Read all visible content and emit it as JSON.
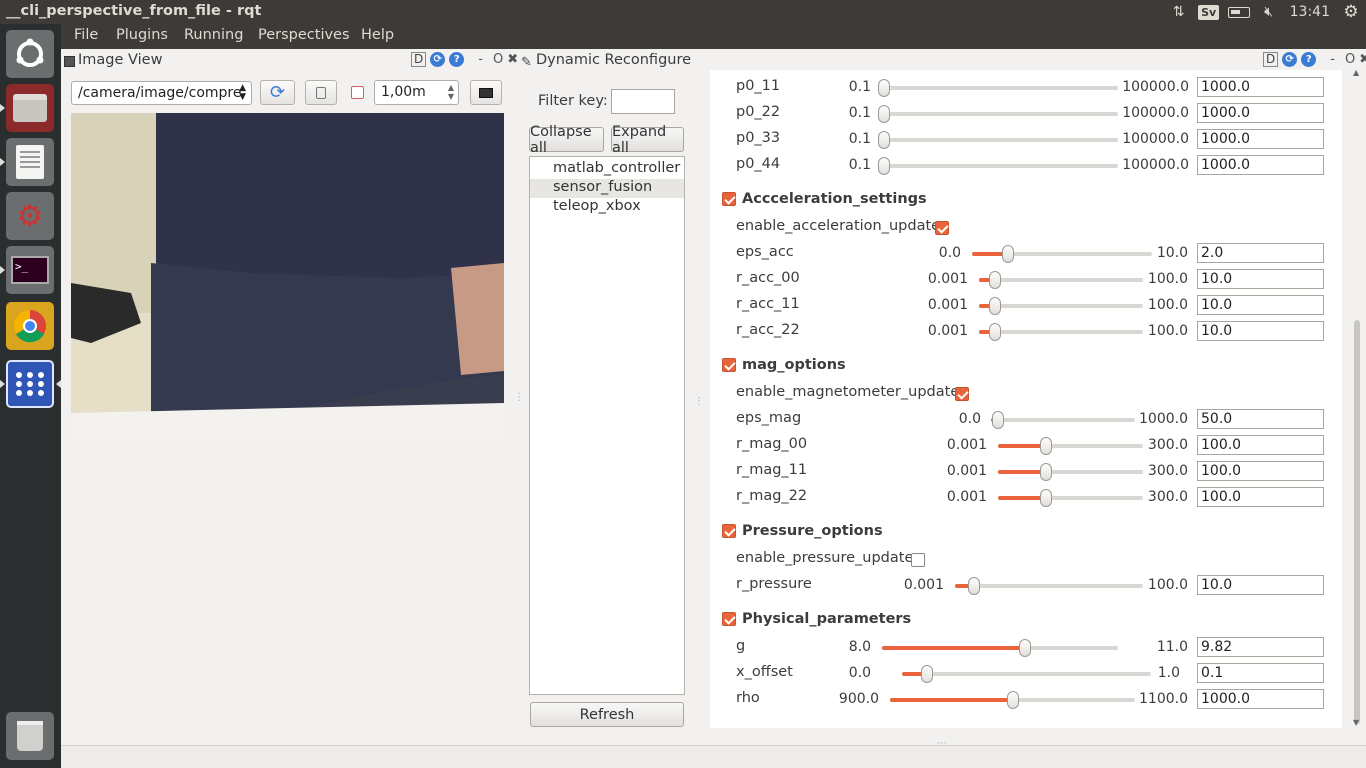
{
  "window": {
    "title": "__cli_perspective_from_file - rqt"
  },
  "tray": {
    "kbd_layout": "Sv",
    "time": "13:41"
  },
  "launcher": {
    "icons": [
      "ubuntu-dash-icon",
      "file-manager-icon",
      "text-editor-icon",
      "settings-icon",
      "terminal-icon",
      "chrome-icon",
      "apps-grid-icon"
    ],
    "trash": "trash-icon"
  },
  "menubar": {
    "items": [
      "File",
      "Plugins",
      "Running",
      "Perspectives",
      "Help"
    ]
  },
  "image_view": {
    "title": "Image View",
    "topic": "/camera/image/compre",
    "zoom": "1,00m"
  },
  "dyn_reconf": {
    "title": "Dynamic Reconfigure",
    "filter_label": "Filter key:",
    "filter_value": "",
    "collapse_label": "Collapse all",
    "expand_label": "Expand all",
    "refresh_label": "Refresh",
    "nodes": [
      "matlab_controller",
      "sensor_fusion",
      "teleop_xbox"
    ],
    "selected_node": "sensor_fusion"
  },
  "params_top": [
    {
      "name": "p0_11",
      "min": "0.1",
      "max": "100000.0",
      "value": "1000.0",
      "level": 0.01
    },
    {
      "name": "p0_22",
      "min": "0.1",
      "max": "100000.0",
      "value": "1000.0",
      "level": 0.01
    },
    {
      "name": "p0_33",
      "min": "0.1",
      "max": "100000.0",
      "value": "1000.0",
      "level": 0.01
    },
    {
      "name": "p0_44",
      "min": "0.1",
      "max": "100000.0",
      "value": "1000.0",
      "level": 0.01
    }
  ],
  "groups": {
    "acc": {
      "title": "Accceleration_settings",
      "toggle_label": "enable_acceleration_update",
      "toggle_on": true,
      "params": [
        {
          "name": "eps_acc",
          "min": "0.0",
          "max": "10.0",
          "value": "2.0",
          "level": 0.2
        },
        {
          "name": "r_acc_00",
          "min": "0.001",
          "max": "100.0",
          "value": "10.0",
          "level": 0.1
        },
        {
          "name": "r_acc_11",
          "min": "0.001",
          "max": "100.0",
          "value": "10.0",
          "level": 0.1
        },
        {
          "name": "r_acc_22",
          "min": "0.001",
          "max": "100.0",
          "value": "10.0",
          "level": 0.1
        }
      ]
    },
    "mag": {
      "title": "mag_options",
      "toggle_label": "enable_magnetometer_update",
      "toggle_on": true,
      "params": [
        {
          "name": "eps_mag",
          "min": "0.0",
          "max": "1000.0",
          "value": "50.0",
          "level": 0.05
        },
        {
          "name": "r_mag_00",
          "min": "0.001",
          "max": "300.0",
          "value": "100.0",
          "level": 0.333
        },
        {
          "name": "r_mag_11",
          "min": "0.001",
          "max": "300.0",
          "value": "100.0",
          "level": 0.333
        },
        {
          "name": "r_mag_22",
          "min": "0.001",
          "max": "300.0",
          "value": "100.0",
          "level": 0.333
        }
      ]
    },
    "pressure": {
      "title": "Pressure_options",
      "toggle_label": "enable_pressure_update",
      "toggle_on": false,
      "params": [
        {
          "name": "r_pressure",
          "min": "0.001",
          "max": "100.0",
          "value": "10.0",
          "level": 0.1
        }
      ]
    },
    "phys": {
      "title": "Physical_parameters",
      "params": [
        {
          "name": "g",
          "min": "8.0",
          "max": "11.0",
          "value": "9.82",
          "level": 0.607
        },
        {
          "name": "x_offset",
          "min": "0.0",
          "max": "1.0",
          "value": "0.1",
          "level": 0.1
        },
        {
          "name": "rho",
          "min": "900.0",
          "max": "1100.0",
          "value": "1000.0",
          "level": 0.5
        }
      ]
    }
  },
  "colors": {
    "accent": "#e9643a",
    "panel": "#3c3b37",
    "launcher": "#2b2e2f"
  }
}
